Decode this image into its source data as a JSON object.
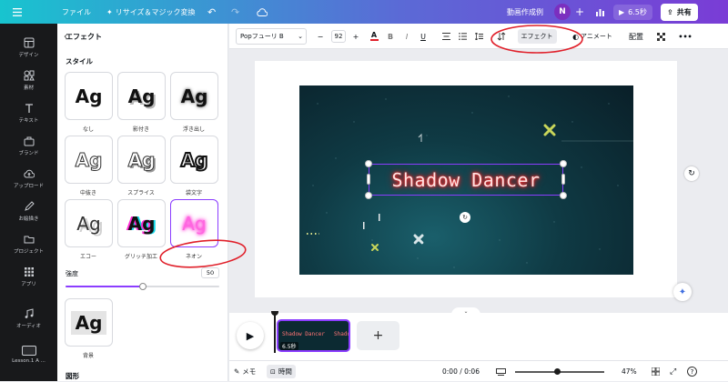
{
  "topbar": {
    "file": "ファイル",
    "resize": "リサイズ＆マジック変換",
    "doc_title": "動画作成例",
    "avatar_initial": "N",
    "duration": "6.5秒",
    "share": "共有"
  },
  "rail": {
    "items": [
      {
        "label": "デザイン",
        "icon": "layout-icon"
      },
      {
        "label": "素材",
        "icon": "elements-icon"
      },
      {
        "label": "テキスト",
        "icon": "text-icon"
      },
      {
        "label": "ブランド",
        "icon": "brand-icon"
      },
      {
        "label": "アップロード",
        "icon": "upload-icon"
      },
      {
        "label": "お絵描き",
        "icon": "draw-icon"
      },
      {
        "label": "プロジェクト",
        "icon": "folder-icon"
      },
      {
        "label": "アプリ",
        "icon": "apps-icon"
      },
      {
        "label": "オーディオ",
        "icon": "music-icon"
      },
      {
        "label": "Lesson.1 A ...",
        "icon": "thumbnail"
      }
    ]
  },
  "panel": {
    "title": "エフェクト",
    "section_style": "スタイル",
    "sample": "Ag",
    "styles": [
      "なし",
      "影付き",
      "浮き出し",
      "中抜き",
      "スプライス",
      "袋文字",
      "エコー",
      "グリッチ加工",
      "ネオン"
    ],
    "strength_label": "強度",
    "strength_value": "50",
    "strength_fraction": 0.5,
    "background_label": "背景",
    "shape_label": "図形"
  },
  "toolbar": {
    "font": "Popフューリ B",
    "font_size": "92",
    "effect": "エフェクト",
    "animate": "アニメート",
    "position": "配置"
  },
  "canvas": {
    "headline": "Shadow Dancer",
    "neon_color": "#ff6a6a"
  },
  "timeline": {
    "clip_duration": "6.5秒",
    "clip_text": "Shadow Dancer"
  },
  "bottombar": {
    "memo": "メモ",
    "time": "時間",
    "timecode": "0:00 / 0:06",
    "zoom": "47%",
    "zoom_fraction": 0.47
  },
  "colors": {
    "accent": "#8b3dff",
    "annotation": "#e0202a"
  }
}
